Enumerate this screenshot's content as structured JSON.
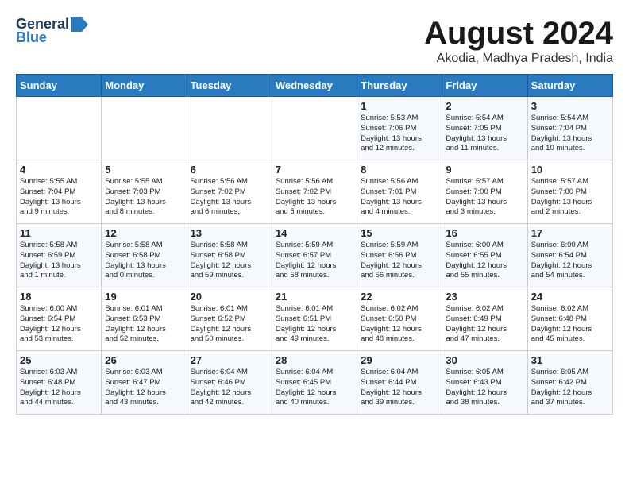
{
  "logo": {
    "general": "General",
    "blue": "Blue"
  },
  "title": "August 2024",
  "location": "Akodia, Madhya Pradesh, India",
  "weekdays": [
    "Sunday",
    "Monday",
    "Tuesday",
    "Wednesday",
    "Thursday",
    "Friday",
    "Saturday"
  ],
  "weeks": [
    [
      {
        "day": "",
        "info": ""
      },
      {
        "day": "",
        "info": ""
      },
      {
        "day": "",
        "info": ""
      },
      {
        "day": "",
        "info": ""
      },
      {
        "day": "1",
        "info": "Sunrise: 5:53 AM\nSunset: 7:06 PM\nDaylight: 13 hours\nand 12 minutes."
      },
      {
        "day": "2",
        "info": "Sunrise: 5:54 AM\nSunset: 7:05 PM\nDaylight: 13 hours\nand 11 minutes."
      },
      {
        "day": "3",
        "info": "Sunrise: 5:54 AM\nSunset: 7:04 PM\nDaylight: 13 hours\nand 10 minutes."
      }
    ],
    [
      {
        "day": "4",
        "info": "Sunrise: 5:55 AM\nSunset: 7:04 PM\nDaylight: 13 hours\nand 9 minutes."
      },
      {
        "day": "5",
        "info": "Sunrise: 5:55 AM\nSunset: 7:03 PM\nDaylight: 13 hours\nand 8 minutes."
      },
      {
        "day": "6",
        "info": "Sunrise: 5:56 AM\nSunset: 7:02 PM\nDaylight: 13 hours\nand 6 minutes."
      },
      {
        "day": "7",
        "info": "Sunrise: 5:56 AM\nSunset: 7:02 PM\nDaylight: 13 hours\nand 5 minutes."
      },
      {
        "day": "8",
        "info": "Sunrise: 5:56 AM\nSunset: 7:01 PM\nDaylight: 13 hours\nand 4 minutes."
      },
      {
        "day": "9",
        "info": "Sunrise: 5:57 AM\nSunset: 7:00 PM\nDaylight: 13 hours\nand 3 minutes."
      },
      {
        "day": "10",
        "info": "Sunrise: 5:57 AM\nSunset: 7:00 PM\nDaylight: 13 hours\nand 2 minutes."
      }
    ],
    [
      {
        "day": "11",
        "info": "Sunrise: 5:58 AM\nSunset: 6:59 PM\nDaylight: 13 hours\nand 1 minute."
      },
      {
        "day": "12",
        "info": "Sunrise: 5:58 AM\nSunset: 6:58 PM\nDaylight: 13 hours\nand 0 minutes."
      },
      {
        "day": "13",
        "info": "Sunrise: 5:58 AM\nSunset: 6:58 PM\nDaylight: 12 hours\nand 59 minutes."
      },
      {
        "day": "14",
        "info": "Sunrise: 5:59 AM\nSunset: 6:57 PM\nDaylight: 12 hours\nand 58 minutes."
      },
      {
        "day": "15",
        "info": "Sunrise: 5:59 AM\nSunset: 6:56 PM\nDaylight: 12 hours\nand 56 minutes."
      },
      {
        "day": "16",
        "info": "Sunrise: 6:00 AM\nSunset: 6:55 PM\nDaylight: 12 hours\nand 55 minutes."
      },
      {
        "day": "17",
        "info": "Sunrise: 6:00 AM\nSunset: 6:54 PM\nDaylight: 12 hours\nand 54 minutes."
      }
    ],
    [
      {
        "day": "18",
        "info": "Sunrise: 6:00 AM\nSunset: 6:54 PM\nDaylight: 12 hours\nand 53 minutes."
      },
      {
        "day": "19",
        "info": "Sunrise: 6:01 AM\nSunset: 6:53 PM\nDaylight: 12 hours\nand 52 minutes."
      },
      {
        "day": "20",
        "info": "Sunrise: 6:01 AM\nSunset: 6:52 PM\nDaylight: 12 hours\nand 50 minutes."
      },
      {
        "day": "21",
        "info": "Sunrise: 6:01 AM\nSunset: 6:51 PM\nDaylight: 12 hours\nand 49 minutes."
      },
      {
        "day": "22",
        "info": "Sunrise: 6:02 AM\nSunset: 6:50 PM\nDaylight: 12 hours\nand 48 minutes."
      },
      {
        "day": "23",
        "info": "Sunrise: 6:02 AM\nSunset: 6:49 PM\nDaylight: 12 hours\nand 47 minutes."
      },
      {
        "day": "24",
        "info": "Sunrise: 6:02 AM\nSunset: 6:48 PM\nDaylight: 12 hours\nand 45 minutes."
      }
    ],
    [
      {
        "day": "25",
        "info": "Sunrise: 6:03 AM\nSunset: 6:48 PM\nDaylight: 12 hours\nand 44 minutes."
      },
      {
        "day": "26",
        "info": "Sunrise: 6:03 AM\nSunset: 6:47 PM\nDaylight: 12 hours\nand 43 minutes."
      },
      {
        "day": "27",
        "info": "Sunrise: 6:04 AM\nSunset: 6:46 PM\nDaylight: 12 hours\nand 42 minutes."
      },
      {
        "day": "28",
        "info": "Sunrise: 6:04 AM\nSunset: 6:45 PM\nDaylight: 12 hours\nand 40 minutes."
      },
      {
        "day": "29",
        "info": "Sunrise: 6:04 AM\nSunset: 6:44 PM\nDaylight: 12 hours\nand 39 minutes."
      },
      {
        "day": "30",
        "info": "Sunrise: 6:05 AM\nSunset: 6:43 PM\nDaylight: 12 hours\nand 38 minutes."
      },
      {
        "day": "31",
        "info": "Sunrise: 6:05 AM\nSunset: 6:42 PM\nDaylight: 12 hours\nand 37 minutes."
      }
    ]
  ]
}
